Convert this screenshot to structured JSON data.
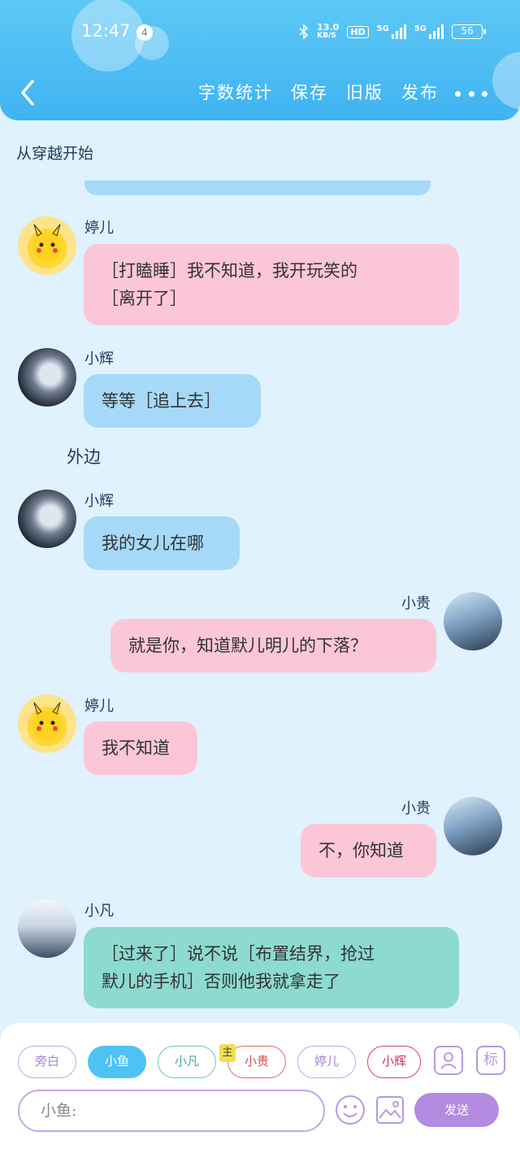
{
  "status_bar": {
    "time": "12:47",
    "notification_count": "4",
    "net_speed_value": "13.0",
    "net_speed_unit": "KB/S",
    "hd_label": "HD",
    "signal1_label": "5G",
    "signal2_label": "5G",
    "battery": "56"
  },
  "toolbar": {
    "word_count_label": "字数统计",
    "save_label": "保存",
    "old_version_label": "旧版",
    "publish_label": "发布"
  },
  "story": {
    "title": "从穿越开始"
  },
  "messages": [
    {
      "side": "left",
      "name": "婷儿",
      "avatar": "pikachu-avatar",
      "color": "#fbc7d6",
      "lines": [
        "［打瞌睡］我不知道，我开玩笑的",
        "［离开了］"
      ]
    },
    {
      "side": "left",
      "name": "小辉",
      "avatar": "dark-boy-avatar",
      "color": "#a5d9f7",
      "lines": [
        "等等［追上去］"
      ]
    },
    {
      "type": "narration",
      "text": "外边"
    },
    {
      "side": "left",
      "name": "小辉",
      "avatar": "dark-boy-avatar",
      "color": "#a5d9f7",
      "lines": [
        "我的女儿在哪"
      ]
    },
    {
      "side": "right",
      "name": "小贵",
      "avatar": "boy-avatar",
      "color": "#fbc7d6",
      "lines": [
        "就是你，知道默儿明儿的下落？"
      ]
    },
    {
      "side": "left",
      "name": "婷儿",
      "avatar": "pikachu-avatar",
      "color": "#fbc7d6",
      "lines": [
        "我不知道"
      ]
    },
    {
      "side": "right",
      "name": "小贵",
      "avatar": "boy-avatar",
      "color": "#fbc7d6",
      "lines": [
        "不，你知道"
      ]
    },
    {
      "side": "left",
      "name": "小凡",
      "avatar": "fan-avatar",
      "color": "#8ddad1",
      "lines": [
        "［过来了］说不说［布置结界，抢过",
        "默儿的手机］否则他我就拿走了"
      ]
    }
  ],
  "bottom": {
    "characters": [
      "旁白",
      "小鱼",
      "小凡",
      "小贵",
      "婷儿",
      "小辉"
    ],
    "selected_character": "小鱼",
    "main_badge": "主",
    "profile_icon": "person-card-icon",
    "tag_label": "标",
    "input_prefix": "小鱼:",
    "send_label": "发送"
  }
}
